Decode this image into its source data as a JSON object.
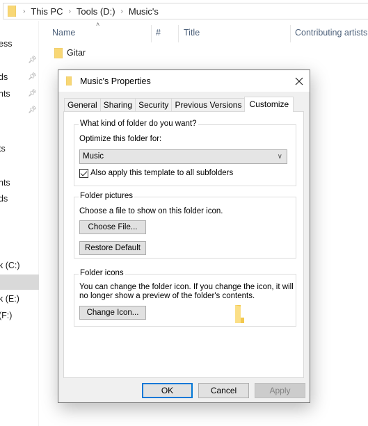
{
  "explorer": {
    "breadcrumb": [
      "This PC",
      "Tools (D:)",
      "Music's"
    ],
    "columns": [
      "Name",
      "#",
      "Title",
      "Contributing artists"
    ],
    "files": [
      {
        "name": "Gitar",
        "type": "folder"
      }
    ],
    "nav_items": [
      {
        "label": "ess",
        "pinned": false
      },
      {
        "label": "",
        "pinned": true
      },
      {
        "label": "ds",
        "pinned": true
      },
      {
        "label": "nts",
        "pinned": true
      },
      {
        "label": "",
        "pinned": true
      },
      {
        "label": "ts",
        "pinned": false
      },
      {
        "label": "nts",
        "pinned": false
      },
      {
        "label": "ds",
        "pinned": false
      },
      {
        "label": "k (C:)",
        "pinned": false
      },
      {
        "label": "",
        "pinned": false,
        "selected": true
      },
      {
        "label": "k (E:)",
        "pinned": false
      },
      {
        "label": "(F:)",
        "pinned": false
      }
    ]
  },
  "dialog": {
    "title": "Music's Properties",
    "close_icon": "close-icon",
    "tabs": [
      {
        "label": "General",
        "active": false
      },
      {
        "label": "Sharing",
        "active": false
      },
      {
        "label": "Security",
        "active": false
      },
      {
        "label": "Previous Versions",
        "active": false
      },
      {
        "label": "Customize",
        "active": true
      }
    ],
    "folder_type": {
      "legend": "What kind of folder do you want?",
      "optimize_label": "Optimize this folder for:",
      "selected_option": "Music",
      "apply_subfolders_label": "Also apply this template to all subfolders",
      "apply_subfolders_checked": true
    },
    "folder_pictures": {
      "legend": "Folder pictures",
      "description": "Choose a file to show on this folder icon.",
      "choose_file_label": "Choose File...",
      "restore_default_label": "Restore Default"
    },
    "folder_icons": {
      "legend": "Folder icons",
      "description_line1": "You can change the folder icon. If you change the icon, it will",
      "description_line2": "no longer show a preview of the folder's contents.",
      "change_icon_label": "Change Icon..."
    },
    "buttons": {
      "ok": "OK",
      "cancel": "Cancel",
      "apply": "Apply",
      "apply_enabled": false
    }
  },
  "colors": {
    "accent": "#0078d7",
    "folder_yellow": "#f8d775",
    "column_header_text": "#4c607a"
  }
}
